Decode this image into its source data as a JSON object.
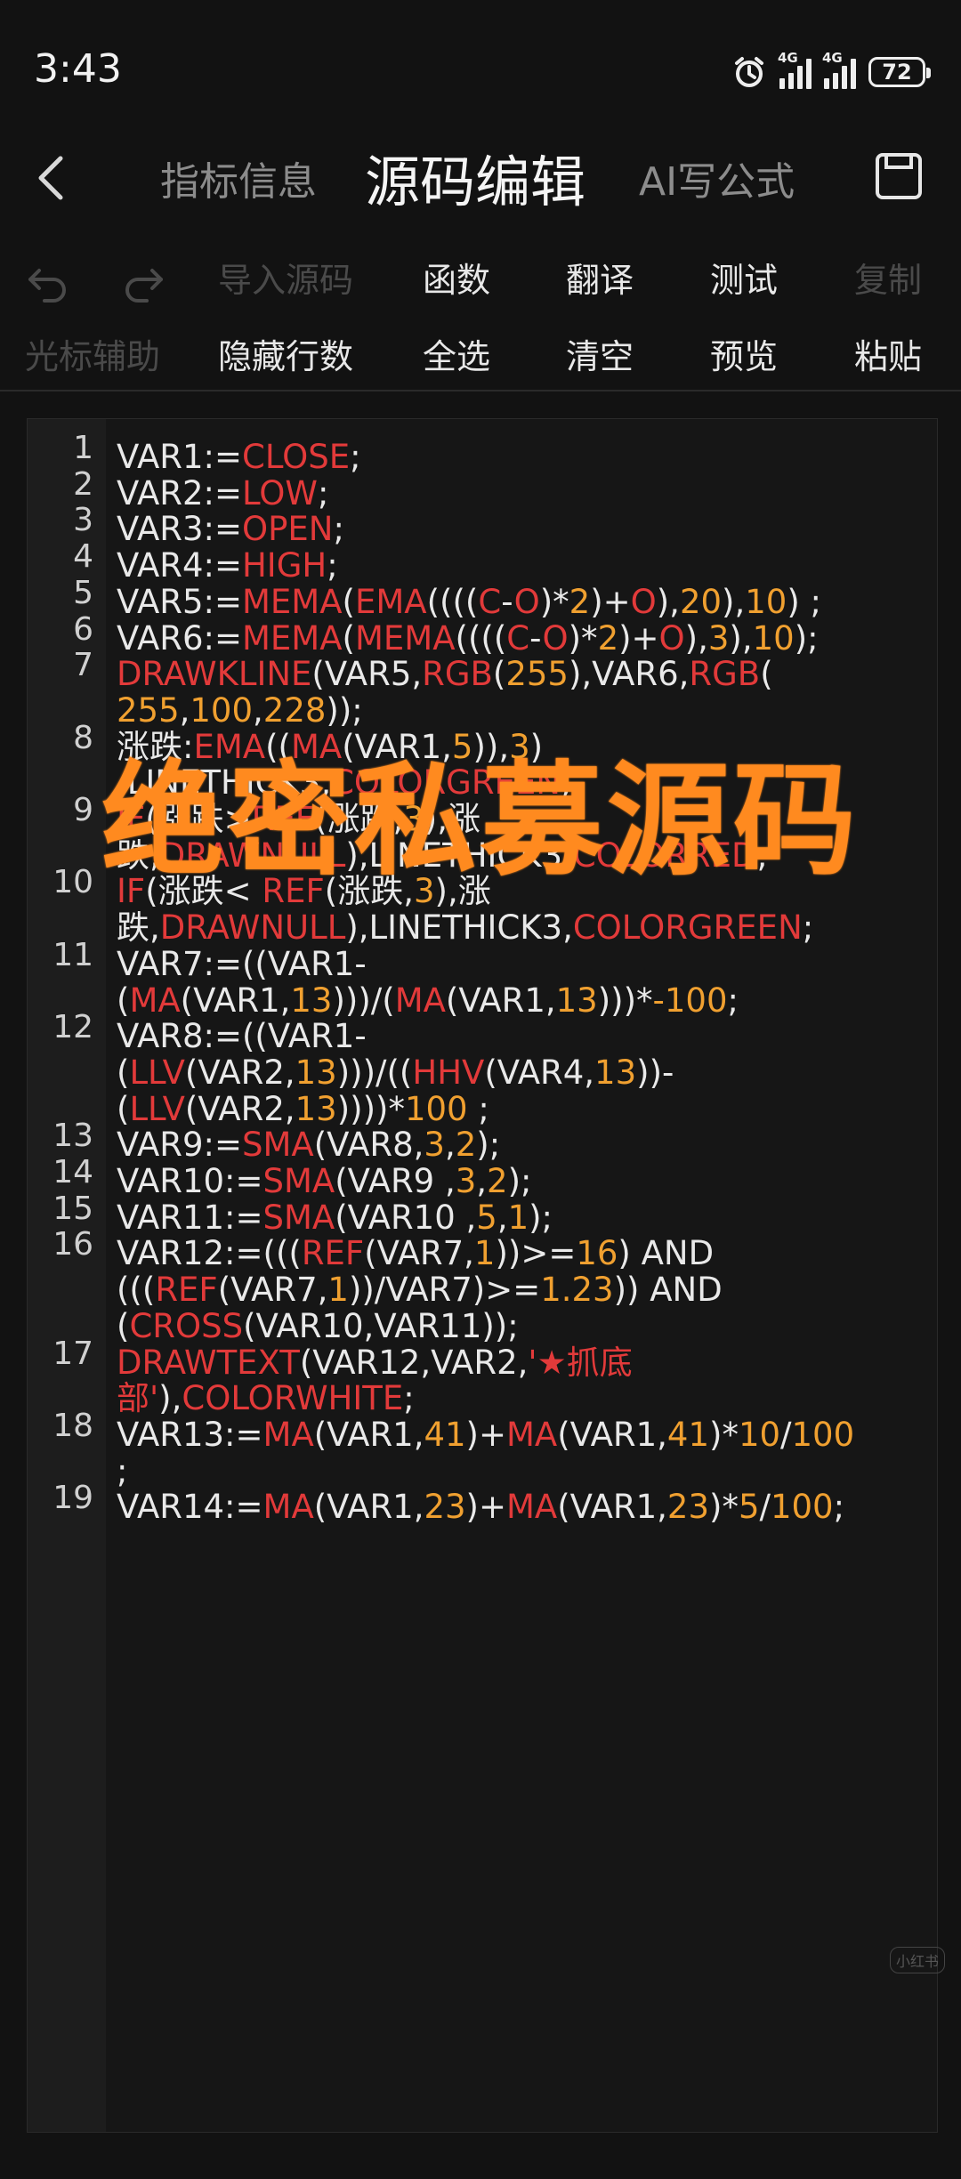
{
  "status": {
    "time": "3:43",
    "signal1_label": "4G",
    "signal2_label": "4G",
    "battery": "72"
  },
  "header": {
    "tabs": [
      {
        "label": "指标信息"
      },
      {
        "label": "源码编辑"
      },
      {
        "label": "AI写公式"
      }
    ]
  },
  "toolbar": {
    "row1": [
      "导入源码",
      "函数",
      "翻译",
      "测试",
      "复制"
    ],
    "row2": [
      "光标辅助",
      "隐藏行数",
      "全选",
      "清空",
      "预览",
      "粘贴"
    ]
  },
  "overlay": {
    "title": "绝密私募源码"
  },
  "watermark": "小红书",
  "code": {
    "line_numbers": [
      "1",
      "2",
      "3",
      "4",
      "5",
      "6",
      "7",
      "8",
      "9",
      "10",
      "11",
      "12",
      "13",
      "14",
      "15",
      "16",
      "17",
      "18",
      "19"
    ],
    "lines": [
      [
        "VAR1:=",
        "CLOSE",
        ";"
      ],
      [
        "VAR2:=",
        "LOW",
        ";"
      ],
      [
        "VAR3:=",
        "OPEN",
        ";"
      ],
      [
        "VAR4:=",
        "HIGH",
        ";"
      ],
      [
        "VAR5:=",
        "MEMA",
        "(",
        "EMA",
        "((((",
        "C",
        "-",
        "O",
        ")*",
        "2",
        ")+",
        "O",
        "),",
        "20",
        "),",
        "10",
        ") ;"
      ],
      [
        "VAR6:=",
        "MEMA",
        "(",
        "MEMA",
        "((((",
        "C",
        "-",
        "O",
        ")*",
        "2",
        ")+",
        "O",
        "),",
        "3",
        "),",
        "10",
        ");"
      ],
      [
        "DRAWKLINE",
        "(VAR5,",
        "RGB",
        "(",
        "255",
        "),VAR6,",
        "RGB",
        "("
      ],
      [
        "255",
        ",",
        "100",
        ",",
        "228",
        "));"
      ],
      [
        "涨跌:",
        "EMA",
        "((",
        "MA",
        "(VAR1,",
        "5",
        ")),",
        "3",
        ")"
      ],
      [
        ",LINETHICK3,",
        "COLORGREEN",
        ";"
      ],
      [
        "IF",
        "(涨跌>",
        "REF",
        "(涨跌,",
        "3",
        "),涨"
      ],
      [
        "跌,",
        "DRAWNULL",
        "),LINETHICK3,",
        "COLORRED",
        ";"
      ],
      [
        "IF",
        "(涨跌< ",
        "REF",
        "(涨跌,",
        "3",
        "),涨"
      ],
      [
        "跌,",
        "DRAWNULL",
        "),LINETHICK3,",
        "COLORGREEN",
        ";"
      ],
      [
        "VAR7:=((VAR1-"
      ],
      [
        "(",
        "MA",
        "(VAR1,",
        "13",
        ")))/(",
        "MA",
        "(VAR1,",
        "13",
        ")))*",
        "-100",
        ";"
      ],
      [
        "VAR8:=((VAR1-"
      ],
      [
        "(",
        "LLV",
        "(VAR2,",
        "13",
        ")))/((",
        "HHV",
        "(VAR4,",
        "13",
        "))-"
      ],
      [
        "(",
        "LLV",
        "(VAR2,",
        "13",
        "))))*",
        "100",
        " ;"
      ],
      [
        "VAR9:=",
        "SMA",
        "(VAR8,",
        "3",
        ",",
        "2",
        ");"
      ],
      [
        "VAR10:=",
        "SMA",
        "(VAR9 ,",
        "3",
        ",",
        "2",
        ");"
      ],
      [
        "VAR11:=",
        "SMA",
        "(VAR10 ,",
        "5",
        ",",
        "1",
        ");"
      ],
      [
        "VAR12:=(((",
        "REF",
        "(VAR7,",
        "1",
        "))>=",
        "16",
        ") AND"
      ],
      [
        "(((",
        "REF",
        "(VAR7,",
        "1",
        "))/VAR7)>=",
        "1.23",
        ")) AND"
      ],
      [
        "(",
        "CROSS",
        "(VAR10,VAR11));"
      ],
      [
        "DRAWTEXT",
        "(VAR12,VAR2,",
        "'★抓底"
      ],
      [
        "部'",
        "),",
        "COLORWHITE",
        ";"
      ],
      [
        "VAR13:=",
        "MA",
        "(VAR1,",
        "41",
        ")+",
        "MA",
        "(VAR1,",
        "41",
        ")*",
        "10",
        "/",
        "100"
      ],
      [
        ";"
      ],
      [
        "VAR14:=",
        "MA",
        "(VAR1,",
        "23",
        ")+",
        "MA",
        "(VAR1,",
        "23",
        ")*",
        "5",
        "/",
        "100",
        ";"
      ]
    ]
  }
}
